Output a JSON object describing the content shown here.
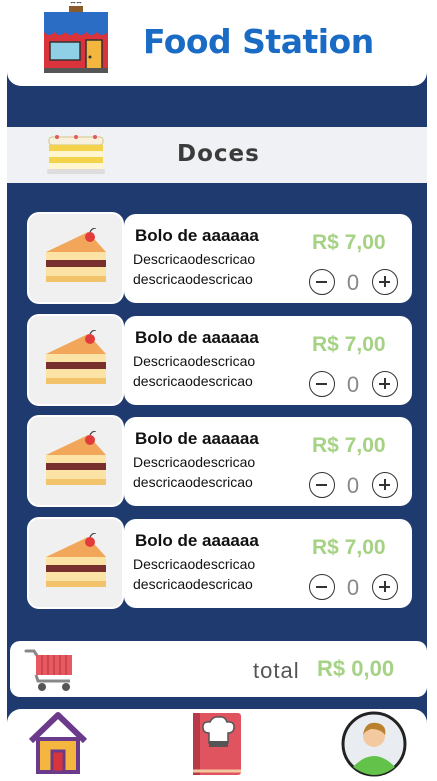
{
  "app": {
    "title": "Food Station",
    "logo_icon": "store-icon"
  },
  "category": {
    "label": "Doces",
    "icon": "layer-cake-icon"
  },
  "products": [
    {
      "name": "Bolo de aaaaaa",
      "desc1": "Descricaodescricao",
      "desc2": "descricaodescricao",
      "price": "R$ 7,00",
      "qty": "0",
      "icon": "cake-slice-icon"
    },
    {
      "name": "Bolo de aaaaaa",
      "desc1": "Descricaodescricao",
      "desc2": "descricaodescricao",
      "price": "R$ 7,00",
      "qty": "0",
      "icon": "cake-slice-icon"
    },
    {
      "name": "Bolo de aaaaaa",
      "desc1": "Descricaodescricao",
      "desc2": "descricaodescricao",
      "price": "R$ 7,00",
      "qty": "0",
      "icon": "cake-slice-icon"
    },
    {
      "name": "Bolo de aaaaaa",
      "desc1": "Descricaodescricao",
      "desc2": "descricaodescricao",
      "price": "R$ 7,00",
      "qty": "0",
      "icon": "cake-slice-icon"
    }
  ],
  "cart": {
    "total_label": "total",
    "total_value": "R$ 0,00",
    "icon": "shopping-cart-icon"
  },
  "nav": {
    "home_icon": "home-icon",
    "menu_icon": "recipe-book-icon",
    "profile_icon": "user-avatar-icon"
  },
  "colors": {
    "background": "#1e3a6e",
    "title": "#1a6bc4",
    "price": "#a5d284"
  }
}
